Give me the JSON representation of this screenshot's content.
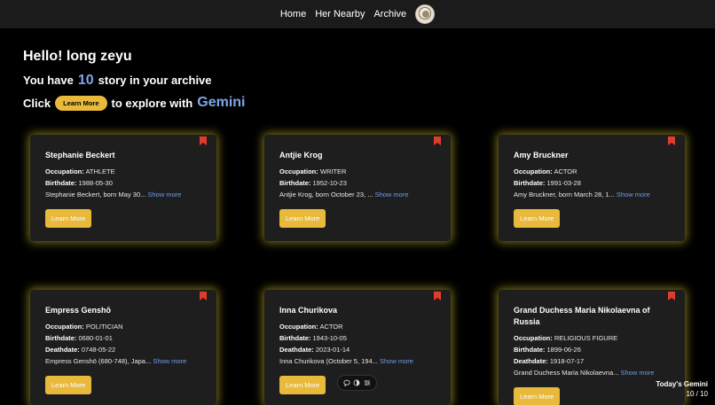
{
  "nav": {
    "items": [
      "Home",
      "Her Nearby",
      "Archive"
    ]
  },
  "hero": {
    "greeting": "Hello! long zeyu",
    "story_prefix": "You have",
    "story_count": "10",
    "story_suffix": "story in your archive",
    "click_prefix": "Click",
    "button_label": "Learn More",
    "click_mid": "to explore with",
    "gemini": "Gemini"
  },
  "labels": {
    "occupation": "Occupation:",
    "birthdate": "Birthdate:",
    "deathdate": "Deathdate:",
    "show_more": "Show more",
    "learn_more": "Learn More"
  },
  "cards": [
    {
      "name": "Stephanie Beckert",
      "occupation": "ATHLETE",
      "birthdate": "1988-05-30",
      "bio": "Stephanie Beckert, born May 30..."
    },
    {
      "name": "Antjie Krog",
      "occupation": "WRITER",
      "birthdate": "1952-10-23",
      "bio": "Antjie Krog, born October 23, ..."
    },
    {
      "name": "Amy Bruckner",
      "occupation": "ACTOR",
      "birthdate": "1991-03-28",
      "bio": "Amy Bruckner, born March 28, 1..."
    },
    {
      "name": "Empress Genshō",
      "occupation": "POLITICIAN",
      "birthdate": "0680-01-01",
      "deathdate": "0748-05-22",
      "bio": "Empress Genshō (680-748), Japa..."
    },
    {
      "name": "Inna Churikova",
      "occupation": "ACTOR",
      "birthdate": "1943-10-05",
      "deathdate": "2023-01-14",
      "bio": "Inna Churikova (October 5, 194..."
    },
    {
      "name_line1": "Grand Duchess Maria Nikolaevna of",
      "name_line2": "Russia",
      "occupation": "RELIGIOUS FIGURE",
      "birthdate": "1899-06-26",
      "deathdate": "1918-07-17",
      "bio": "Grand Duchess Maria Nikolaevna..."
    }
  ],
  "today": {
    "title": "Today's Gemini",
    "count": "10 / 10"
  },
  "colors": {
    "accent": "#e8b93b",
    "link": "#6f9cf0",
    "gemini": "#7fa6e8",
    "bookmark": "#e03c2c"
  }
}
